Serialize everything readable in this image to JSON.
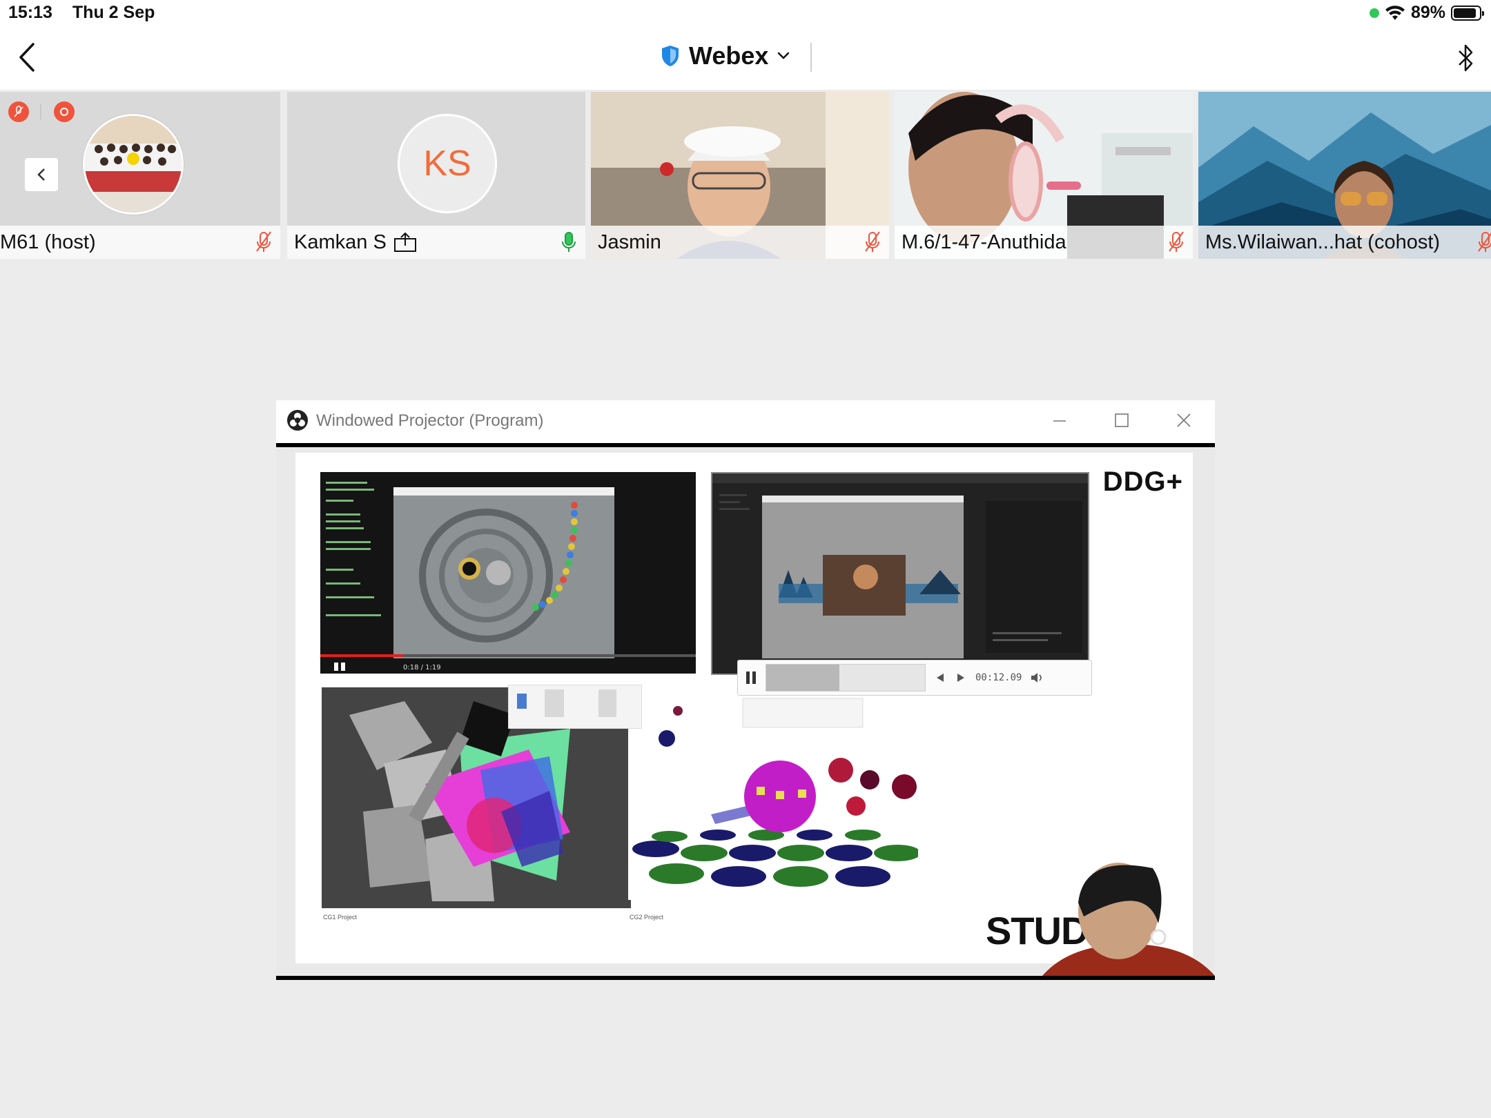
{
  "status_bar": {
    "time": "15:13",
    "date": "Thu 2 Sep",
    "battery": "89%",
    "battery_level": 0.89
  },
  "nav": {
    "title": "Webex"
  },
  "participants": [
    {
      "name": "M61 (host)",
      "mic": "muted"
    },
    {
      "name": "Kamkan S",
      "initials": "KS",
      "mic": "active"
    },
    {
      "name": "Jasmin",
      "mic": "muted"
    },
    {
      "name": "M.6/1-47-Anuthida",
      "mic": "muted"
    },
    {
      "name": "Ms.Wilaiwan...hat (cohost)",
      "mic": "muted"
    }
  ],
  "shared_window": {
    "title": "Windowed Projector (Program)",
    "player_time": "00:12.09",
    "video_time": "0:18 / 1:19",
    "logo": "DDG+",
    "slide_heading": "STUDEN",
    "caption_1": "CG1 Project",
    "caption_2": "CG2 Project"
  },
  "colors": {
    "accent": "#f26b3a",
    "muted_red": "#f0533b",
    "mic_green": "#32c75a",
    "webex_blue": "#1e88e5"
  }
}
